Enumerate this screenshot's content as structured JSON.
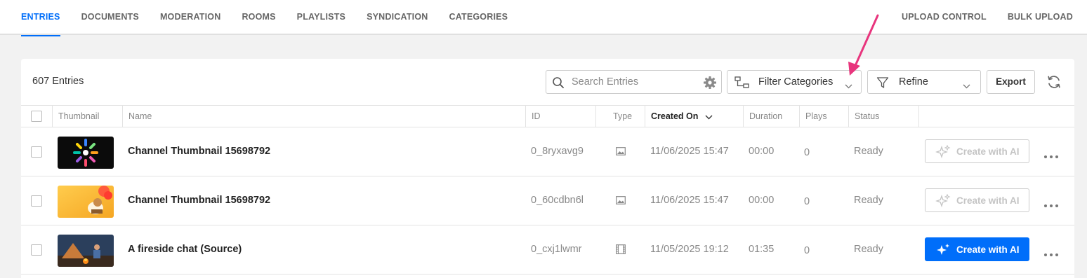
{
  "nav": {
    "left": [
      {
        "label": "ENTRIES",
        "active": true
      },
      {
        "label": "DOCUMENTS"
      },
      {
        "label": "MODERATION"
      },
      {
        "label": "ROOMS"
      },
      {
        "label": "PLAYLISTS"
      },
      {
        "label": "SYNDICATION"
      },
      {
        "label": "CATEGORIES"
      }
    ],
    "right": [
      {
        "label": "UPLOAD CONTROL"
      },
      {
        "label": "BULK UPLOAD"
      }
    ]
  },
  "toolbar": {
    "entries_count": "607 Entries",
    "search_placeholder": "Search Entries",
    "filter_label": "Filter Categories",
    "refine_label": "Refine",
    "export_label": "Export"
  },
  "table": {
    "headers": {
      "thumbnail": "Thumbnail",
      "name": "Name",
      "id": "ID",
      "type": "Type",
      "created_on": "Created On",
      "duration": "Duration",
      "plays": "Plays",
      "status": "Status"
    },
    "sorted_by": "created_on",
    "rows": [
      {
        "name": "Channel Thumbnail 15698792",
        "id": "0_8ryxavg9",
        "type": "image-icon",
        "created_on": "11/06/2025 15:47",
        "duration": "00:00",
        "plays": "0",
        "status": "Ready",
        "ai_label": "Create with AI",
        "ai_enabled": false
      },
      {
        "name": "Channel Thumbnail 15698792",
        "id": "0_60cdbn6l",
        "type": "image-icon",
        "created_on": "11/06/2025 15:47",
        "duration": "00:00",
        "plays": "0",
        "status": "Ready",
        "ai_label": "Create with AI",
        "ai_enabled": false
      },
      {
        "name": "A fireside chat (Source)",
        "id": "0_cxj1lwmr",
        "type": "video-icon",
        "created_on": "11/05/2025 19:12",
        "duration": "01:35",
        "plays": "0",
        "status": "Ready",
        "ai_label": "Create with AI",
        "ai_enabled": true
      }
    ]
  },
  "colors": {
    "accent": "#006efa",
    "annotation_arrow": "#e8357d"
  }
}
